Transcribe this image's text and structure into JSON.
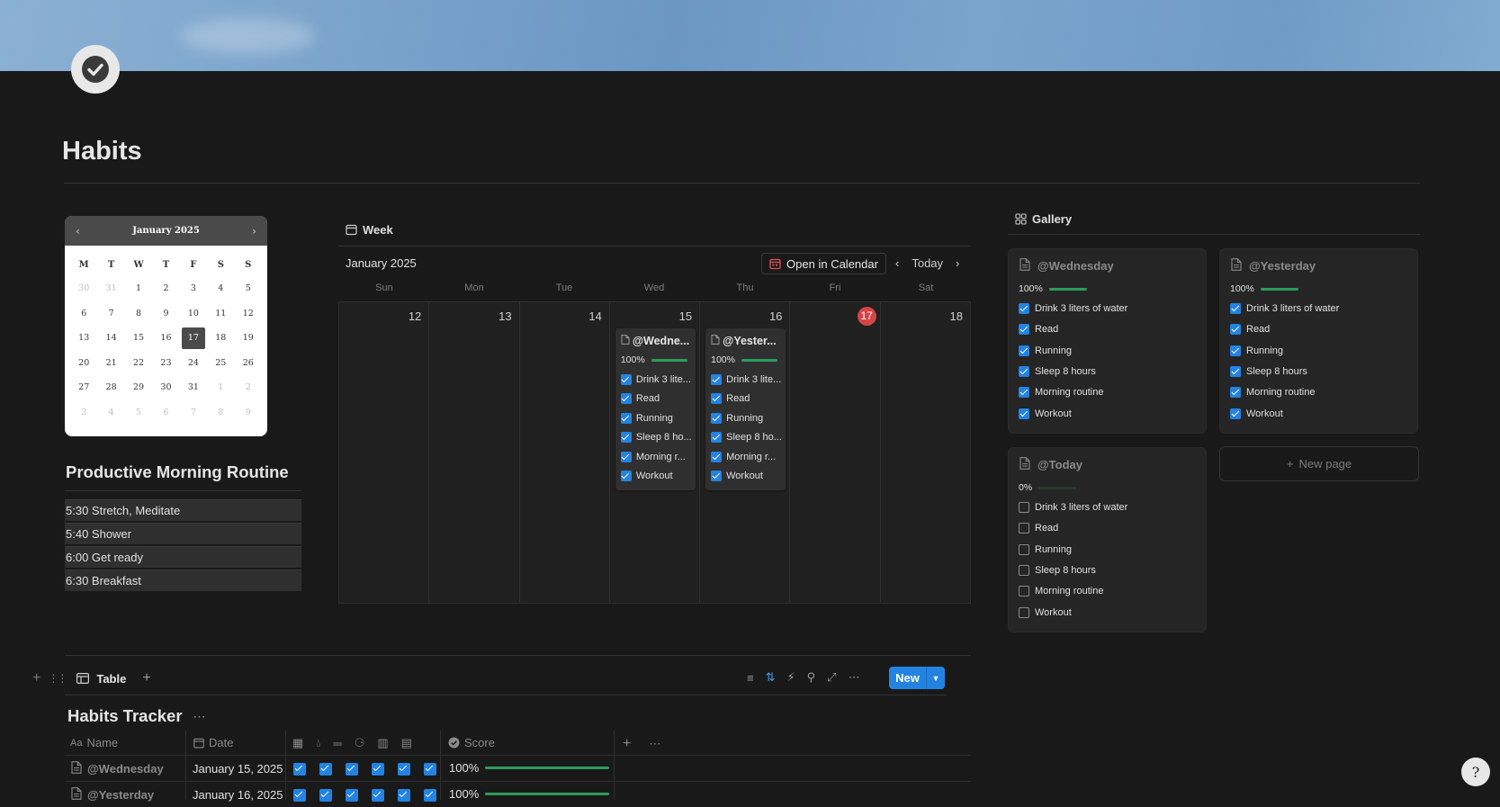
{
  "page": {
    "title": "Habits"
  },
  "mini_calendar": {
    "month_label": "January 2025",
    "weekdays": [
      "M",
      "T",
      "W",
      "T",
      "F",
      "S",
      "S"
    ],
    "weeks": [
      [
        "30",
        "31",
        "1",
        "2",
        "3",
        "4",
        "5"
      ],
      [
        "6",
        "7",
        "8",
        "9",
        "10",
        "11",
        "12"
      ],
      [
        "13",
        "14",
        "15",
        "16",
        "17",
        "18",
        "19"
      ],
      [
        "20",
        "21",
        "22",
        "23",
        "24",
        "25",
        "26"
      ],
      [
        "27",
        "28",
        "29",
        "30",
        "31",
        "1",
        "2"
      ],
      [
        "3",
        "4",
        "5",
        "6",
        "7",
        "8",
        "9"
      ]
    ],
    "selected": "17"
  },
  "routine": {
    "title": "Productive Morning Routine",
    "items": [
      "5:30  Stretch, Meditate",
      "5:40 Shower",
      "6:00 Get ready",
      "6:30  Breakfast"
    ]
  },
  "week_view": {
    "tab_label": "Week",
    "month_label": "January 2025",
    "open_calendar_label": "Open in Calendar",
    "today_label": "Today",
    "day_names": [
      "Sun",
      "Mon",
      "Tue",
      "Wed",
      "Thu",
      "Fri",
      "Sat"
    ],
    "day_numbers": [
      "12",
      "13",
      "14",
      "15",
      "16",
      "17",
      "18"
    ],
    "today_number": "17",
    "events": [
      {
        "title": "@Wedne...",
        "progress": "100%",
        "items": [
          "Drink 3 lite...",
          "Read",
          "Running",
          "Sleep 8 ho...",
          "Morning r...",
          "Workout"
        ]
      },
      {
        "title": "@Yester...",
        "progress": "100%",
        "items": [
          "Drink 3 lite...",
          "Read",
          "Running",
          "Sleep 8 ho...",
          "Morning r...",
          "Workout"
        ]
      }
    ]
  },
  "gallery": {
    "tab_label": "Gallery",
    "cards": [
      {
        "title": "@Wednesday",
        "progress": "100%",
        "checked": true,
        "items": [
          "Drink 3 liters of water",
          "Read",
          "Running",
          "Sleep 8 hours",
          "Morning routine",
          "Workout"
        ]
      },
      {
        "title": "@Yesterday",
        "progress": "100%",
        "checked": true,
        "items": [
          "Drink 3 liters of water",
          "Read",
          "Running",
          "Sleep 8 hours",
          "Morning routine",
          "Workout"
        ]
      },
      {
        "title": "@Today",
        "progress": "0%",
        "checked": false,
        "items": [
          "Drink 3 liters of water",
          "Read",
          "Running",
          "Sleep 8 hours",
          "Morning routine",
          "Workout"
        ]
      }
    ],
    "new_page_label": "New page"
  },
  "table": {
    "view_label": "Table",
    "title": "Habits Tracker",
    "new_label": "New",
    "columns": {
      "name": "Name",
      "date": "Date",
      "score": "Score"
    },
    "rows": [
      {
        "name": "@Wednesday",
        "date": "January 15, 2025",
        "score": "100%",
        "score_fraction": 1.0
      },
      {
        "name": "@Yesterday",
        "date": "January 16, 2025",
        "score": "100%",
        "score_fraction": 1.0
      }
    ]
  },
  "help": {
    "glyph": "?"
  },
  "colors": {
    "accent": "#2383e2",
    "progress": "#2d9c5c",
    "today": "#d64545",
    "background": "#191919"
  }
}
